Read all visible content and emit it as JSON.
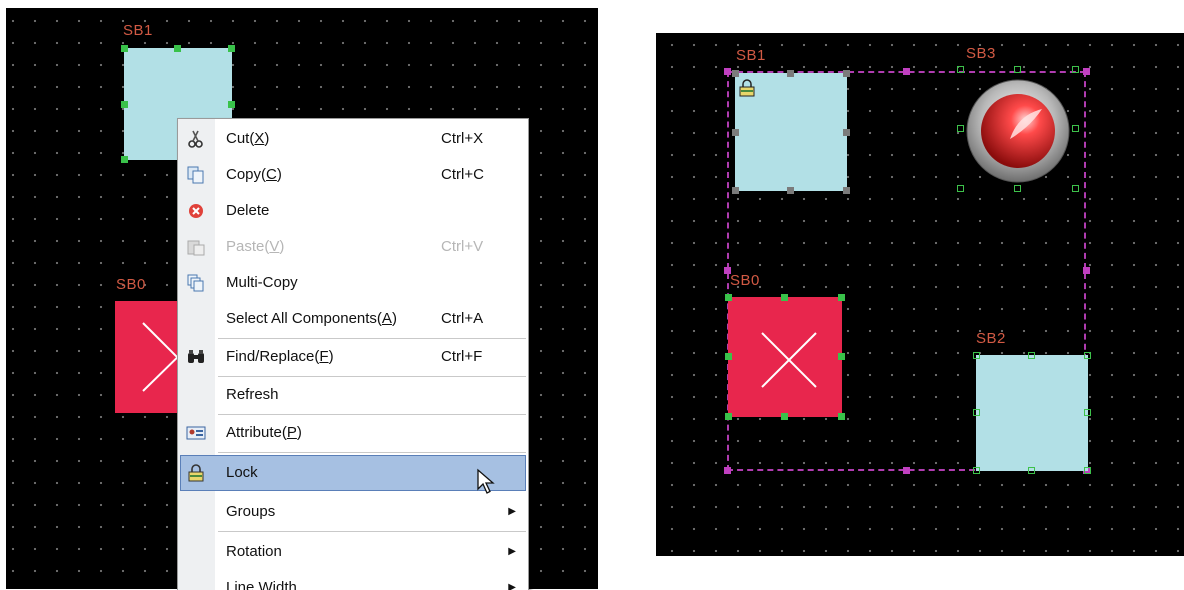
{
  "left_panel": {
    "labels": {
      "sb1": "SB1",
      "sb0": "SB0"
    },
    "context_menu": {
      "items": [
        {
          "label": "Cut(",
          "mnemonic": "X",
          "suffix": ")",
          "shortcut": "Ctrl+X",
          "icon": "scissors-icon"
        },
        {
          "label": "Copy(",
          "mnemonic": "C",
          "suffix": ")",
          "shortcut": "Ctrl+C",
          "icon": "copy-icon"
        },
        {
          "label": "Delete",
          "mnemonic": "",
          "suffix": "",
          "shortcut": "",
          "icon": "delete-icon"
        },
        {
          "label": "Paste(",
          "mnemonic": "V",
          "suffix": ")",
          "shortcut": "Ctrl+V",
          "icon": "paste-icon",
          "disabled": true
        },
        {
          "label": "Multi-Copy",
          "mnemonic": "",
          "suffix": "",
          "shortcut": "",
          "icon": "multi-copy-icon"
        },
        {
          "label": "Select All Components(",
          "mnemonic": "A",
          "suffix": ")",
          "shortcut": "Ctrl+A",
          "icon": ""
        },
        {
          "label": "Find/Replace(",
          "mnemonic": "F",
          "suffix": ")",
          "shortcut": "Ctrl+F",
          "icon": "binoculars-icon"
        },
        {
          "label": "Refresh",
          "mnemonic": "",
          "suffix": "",
          "shortcut": "",
          "icon": ""
        },
        {
          "label": "Attribute(",
          "mnemonic": "P",
          "suffix": ")",
          "shortcut": "",
          "icon": "attribute-icon"
        },
        {
          "label": "Lock",
          "mnemonic": "",
          "suffix": "",
          "shortcut": "",
          "icon": "lock-icon",
          "highlighted": true
        },
        {
          "label": "Groups",
          "mnemonic": "",
          "suffix": "",
          "shortcut": "",
          "icon": "",
          "submenu": true
        },
        {
          "label": "Rotation",
          "mnemonic": "",
          "suffix": "",
          "shortcut": "",
          "icon": "",
          "submenu": true
        },
        {
          "label": "Line Width",
          "mnemonic": "",
          "suffix": "",
          "shortcut": "",
          "icon": "",
          "submenu": true
        }
      ]
    }
  },
  "right_panel": {
    "labels": {
      "sb1": "SB1",
      "sb3": "SB3",
      "sb0": "SB0",
      "sb2": "SB2"
    }
  },
  "colors": {
    "canvas_bg": "#000000",
    "label": "#d25a44",
    "cyan_component": "#b2e0e6",
    "red_component": "#e8264d",
    "selection_handle": "#39c24a",
    "group_border": "#c040c0",
    "menu_highlight": "#a6c0e2"
  }
}
